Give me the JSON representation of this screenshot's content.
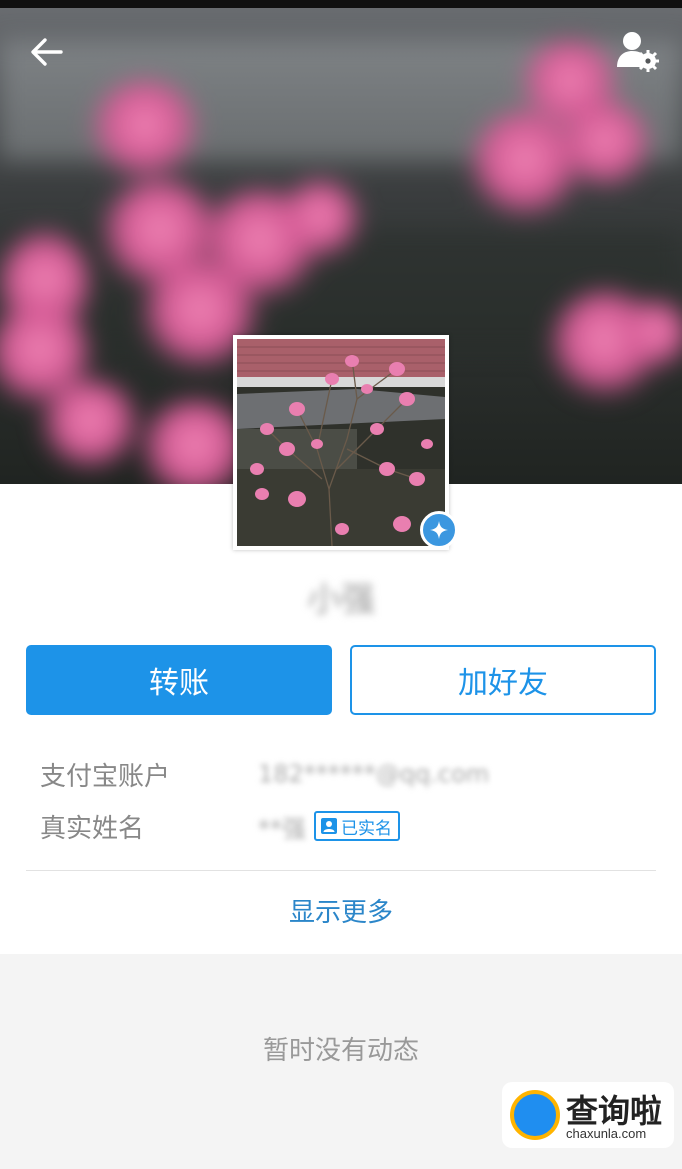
{
  "header": {
    "back_icon": "arrow-left-icon",
    "settings_icon": "user-settings-icon"
  },
  "profile": {
    "nickname": "小强",
    "badge_icon": "verified-star-icon"
  },
  "actions": {
    "transfer_label": "转账",
    "add_friend_label": "加好友"
  },
  "info": [
    {
      "label": "支付宝账户",
      "value": "182******@qq.com"
    },
    {
      "label": "真实姓名",
      "value": "**强",
      "tag": "已实名"
    }
  ],
  "show_more_label": "显示更多",
  "empty_feed_text": "暂时没有动态",
  "watermark": {
    "main": "查询啦",
    "sub": "chaxunla.com"
  },
  "colors": {
    "accent": "#1d93e8",
    "page_bg": "#f4f4f4",
    "link": "#2b86c9"
  }
}
